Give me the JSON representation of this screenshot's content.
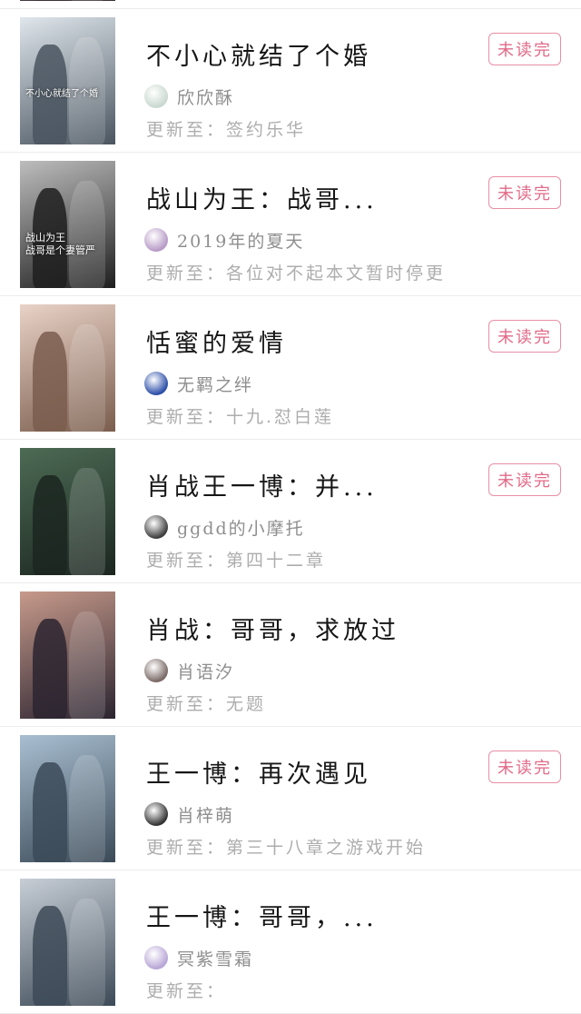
{
  "books": [
    {
      "title": "",
      "author": "",
      "update_prefix": "",
      "update_text": "",
      "badge": "",
      "cover_colors": [
        "#6b5d6a",
        "#3a3038"
      ],
      "avatar_color": "#cccccc"
    },
    {
      "title": "不小心就结了个婚",
      "author": "欣欣酥",
      "update_prefix": "更新至：",
      "update_text": "签约乐华",
      "badge": "未读完",
      "cover_colors": [
        "#dfe6ec",
        "#4a5560"
      ],
      "avatar_color": "#c9d8cf"
    },
    {
      "title": "战山为王：战哥...",
      "author": "2019年的夏天",
      "update_prefix": "更新至：",
      "update_text": "各位对不起本文暂时停更",
      "badge": "未读完",
      "cover_colors": [
        "#bdbdbd",
        "#1f1f1f"
      ],
      "avatar_color": "#b79ac7"
    },
    {
      "title": "恬蜜的爱情",
      "author": "无羁之绊",
      "update_prefix": "更新至：",
      "update_text": "十九.怼白莲",
      "badge": "未读完",
      "cover_colors": [
        "#e9d2c7",
        "#7a5d4d"
      ],
      "avatar_color": "#2c4fa8"
    },
    {
      "title": "肖战王一博：并...",
      "author": "ggdd的小摩托",
      "update_prefix": "更新至：",
      "update_text": "第四十二章",
      "badge": "未读完",
      "cover_colors": [
        "#4d6b55",
        "#1b2620"
      ],
      "avatar_color": "#3e3e3e"
    },
    {
      "title": "肖战：哥哥，求放过",
      "author": "肖语汐",
      "update_prefix": "更新至：",
      "update_text": "无题",
      "badge": "",
      "cover_colors": [
        "#c79a8b",
        "#2b2430"
      ],
      "avatar_color": "#7a6a66"
    },
    {
      "title": "王一博：再次遇见",
      "author": "肖梓萌",
      "update_prefix": "更新至：",
      "update_text": "第三十八章之游戏开始",
      "badge": "未读完",
      "cover_colors": [
        "#a9bfd1",
        "#3b4a58"
      ],
      "avatar_color": "#333333"
    },
    {
      "title": "王一博：哥哥，...",
      "author": "冥紫雪霜",
      "update_prefix": "更新至：",
      "update_text": "",
      "badge": "",
      "cover_colors": [
        "#c7ced6",
        "#3d4a57"
      ],
      "avatar_color": "#b8a6d6"
    }
  ],
  "covers": {
    "book2_overlay": "战山为王\n战哥是个妻管严",
    "book1_overlay": "不小心就结了个婚"
  },
  "colors": {
    "badge_border": "#e88fa5",
    "badge_text": "#e26a88",
    "title_text": "#161616",
    "meta_text": "#adadad"
  }
}
